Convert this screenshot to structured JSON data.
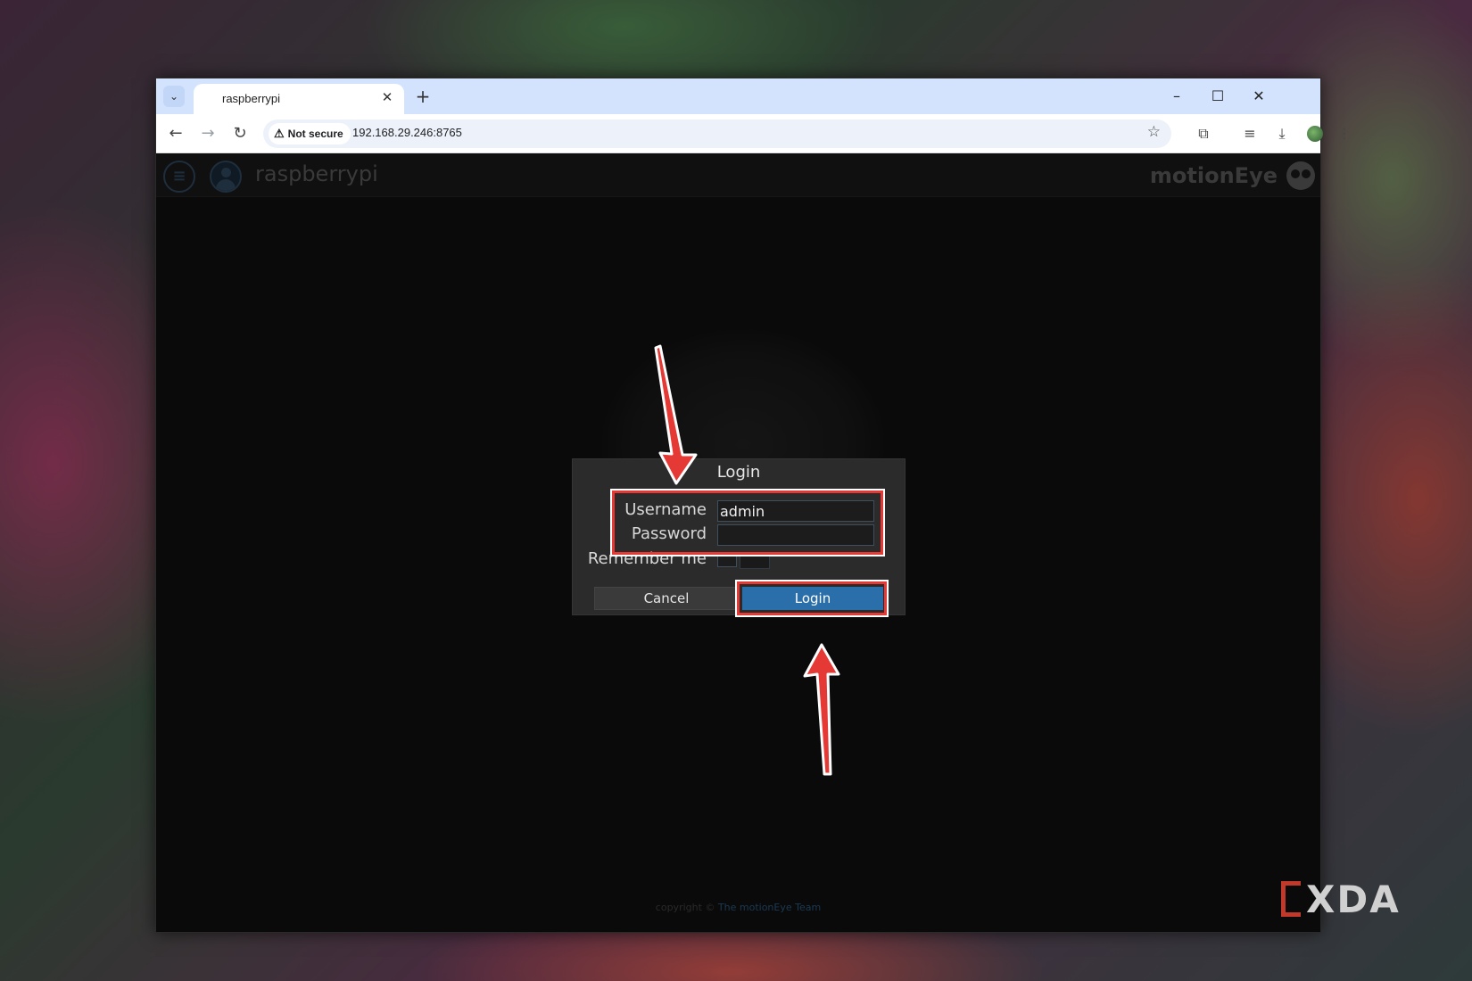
{
  "browser": {
    "tab_title": "raspberrypi",
    "tab_close": "✕",
    "new_tab": "+",
    "window_controls": {
      "minimize": "–",
      "maximize": "☐",
      "close": "✕"
    },
    "nav": {
      "back": "←",
      "forward": "→",
      "reload": "↻"
    },
    "security_label": "Not secure",
    "url": "192.168.29.246:8765",
    "icons": [
      "star-icon",
      "extensions-icon",
      "media-icon",
      "download-icon",
      "profile-icon",
      "menu-icon"
    ]
  },
  "app": {
    "host_title": "raspberrypi",
    "brand": "motionEye",
    "copyright_prefix": "copyright ©",
    "copyright_link": "The motionEye Team"
  },
  "login_dialog": {
    "title": "Login",
    "username_label": "Username",
    "username_value": "admin",
    "password_label": "Password",
    "password_value": "",
    "remember_label": "Remember me",
    "cancel_label": "Cancel",
    "login_label": "Login"
  },
  "annotation": {
    "highlight_color": "#e53935"
  },
  "watermark": {
    "text": "XDA"
  }
}
